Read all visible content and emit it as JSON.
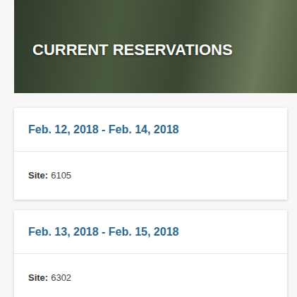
{
  "header": {
    "title": "CURRENT RESERVATIONS"
  },
  "reservations": [
    {
      "dates": "Feb. 12, 2018 - Feb. 14, 2018",
      "site_label": "Site:",
      "site": "6105"
    },
    {
      "dates": "Feb. 13, 2018 - Feb. 15, 2018",
      "site_label": "Site:",
      "site": "6302"
    }
  ]
}
